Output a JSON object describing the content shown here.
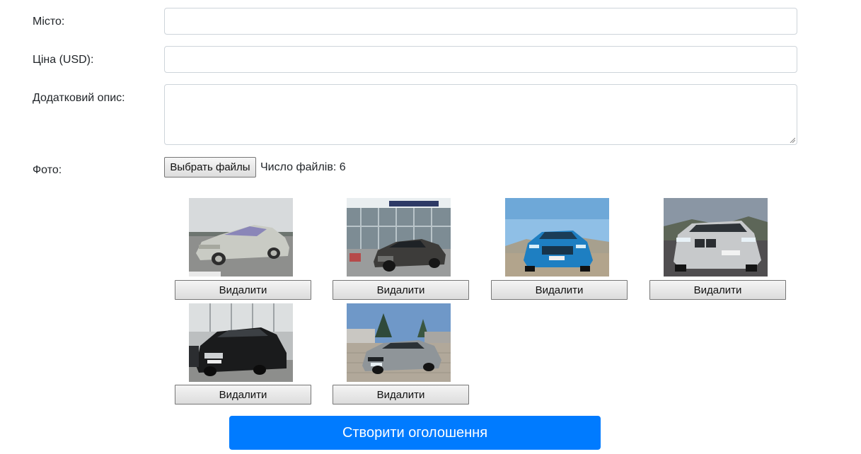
{
  "form": {
    "city": {
      "label": "Місто:",
      "value": ""
    },
    "price": {
      "label": "Ціна (USD):",
      "value": ""
    },
    "description": {
      "label": "Додатковий опис:",
      "value": ""
    },
    "photo": {
      "label": "Фото:",
      "choose_button": "Выбрать файлы",
      "file_count_text": "Число файлів: 6"
    }
  },
  "photos": [
    {
      "alt": "silver sedan",
      "delete_label": "Видалити"
    },
    {
      "alt": "dark sedan at dealership",
      "delete_label": "Видалити"
    },
    {
      "alt": "blue sedan",
      "delete_label": "Видалити"
    },
    {
      "alt": "white SUV",
      "delete_label": "Видалити"
    },
    {
      "alt": "black sedan",
      "delete_label": "Видалити"
    },
    {
      "alt": "grey sedan",
      "delete_label": "Видалити"
    }
  ],
  "submit_label": "Створити оголошення",
  "colors": {
    "primary": "#007bff",
    "border": "#ced4da"
  }
}
